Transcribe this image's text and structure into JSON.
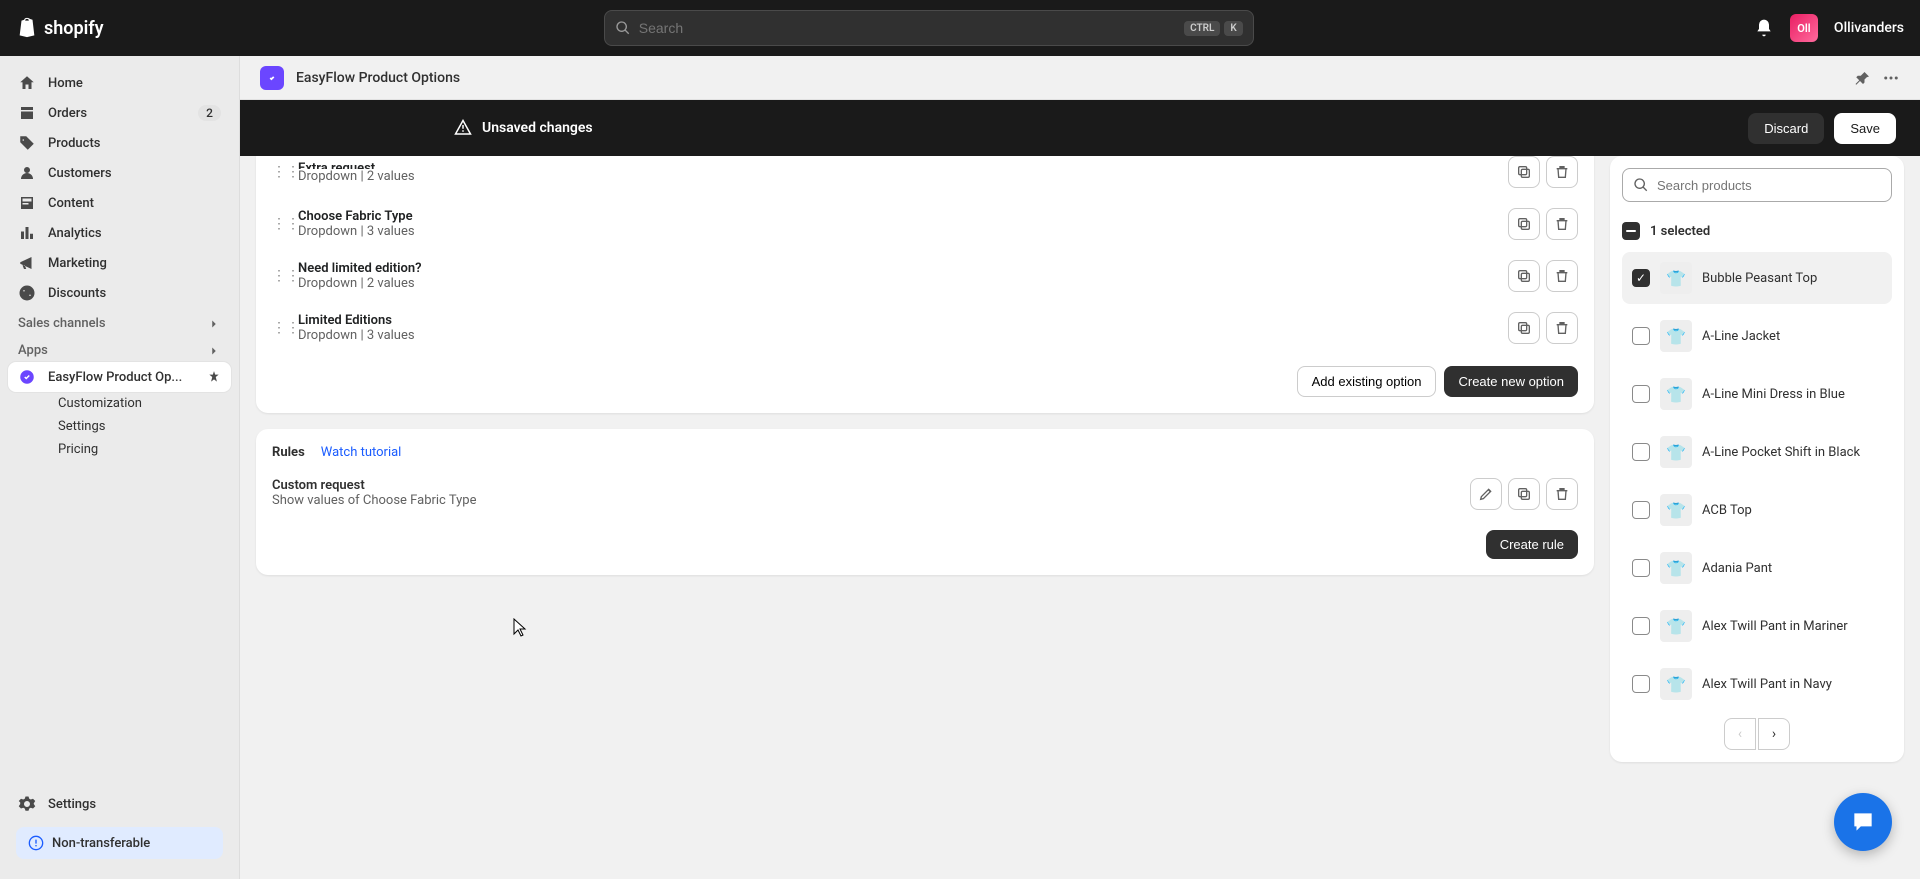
{
  "topbar": {
    "brand": "shopify",
    "search_placeholder": "Search",
    "kbd1": "CTRL",
    "kbd2": "K",
    "avatar_initials": "Oll",
    "username": "Ollivanders"
  },
  "sidebar": {
    "items": [
      {
        "label": "Home"
      },
      {
        "label": "Orders",
        "badge": "2"
      },
      {
        "label": "Products"
      },
      {
        "label": "Customers"
      },
      {
        "label": "Content"
      },
      {
        "label": "Analytics"
      },
      {
        "label": "Marketing"
      },
      {
        "label": "Discounts"
      }
    ],
    "section_sales": "Sales channels",
    "section_apps": "Apps",
    "app_name": "EasyFlow Product Op...",
    "subnav": [
      "Customization",
      "Settings",
      "Pricing"
    ],
    "settings": "Settings",
    "nontransferable": "Non-transferable"
  },
  "app_header": {
    "title": "EasyFlow Product Options"
  },
  "savebar": {
    "text": "Unsaved changes",
    "discard": "Discard",
    "save": "Save"
  },
  "options": [
    {
      "title": "Extra request",
      "meta": "Dropdown | 2 values",
      "truncated": true
    },
    {
      "title": "Choose Fabric Type",
      "meta": "Dropdown | 3 values"
    },
    {
      "title": "Need limited edition?",
      "meta": "Dropdown | 2 values"
    },
    {
      "title": "Limited Editions",
      "meta": "Dropdown | 3 values"
    }
  ],
  "options_actions": {
    "add": "Add existing option",
    "create": "Create new option"
  },
  "rules": {
    "title": "Rules",
    "link": "Watch tutorial",
    "items": [
      {
        "name": "Custom request",
        "desc": "Show values of Choose Fabric Type"
      }
    ],
    "create": "Create rule"
  },
  "products": {
    "search_placeholder": "Search products",
    "selected_text": "1 selected",
    "items": [
      {
        "name": "Bubble Peasant Top",
        "checked": true
      },
      {
        "name": "A-Line Jacket",
        "checked": false
      },
      {
        "name": "A-Line Mini Dress in Blue",
        "checked": false
      },
      {
        "name": "A-Line Pocket Shift in Black",
        "checked": false
      },
      {
        "name": "ACB Top",
        "checked": false
      },
      {
        "name": "Adania Pant",
        "checked": false
      },
      {
        "name": "Alex Twill Pant in Mariner",
        "checked": false
      },
      {
        "name": "Alex Twill Pant in Navy",
        "checked": false
      }
    ]
  }
}
